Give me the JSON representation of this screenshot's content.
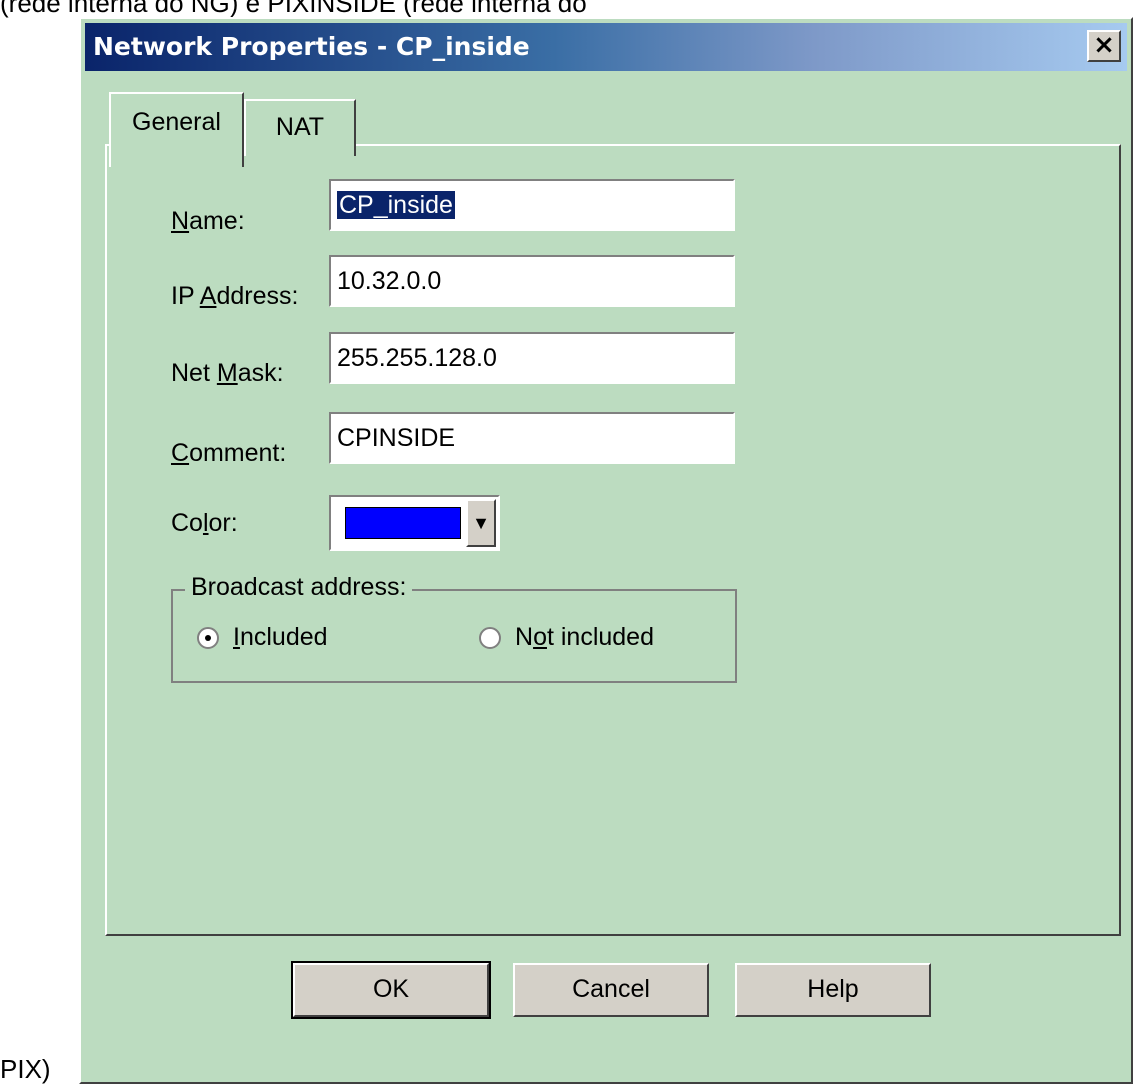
{
  "background_text": {
    "line_top": "(rede interna do                NG) e PIXINSIDE (rede interna do",
    "line_bottom": "PIX)"
  },
  "dialog": {
    "title": "Network Properties - CP_inside",
    "close_label": "×"
  },
  "tabs": [
    {
      "label": "General",
      "selected": true
    },
    {
      "label": "NAT",
      "selected": false
    }
  ],
  "form": {
    "name": {
      "label_prefix": "",
      "label_mnemonic": "N",
      "label_rest": "ame:",
      "value": "CP_inside"
    },
    "ip_address": {
      "label_prefix": "IP ",
      "label_mnemonic": "A",
      "label_rest": "ddress:",
      "value": "10.32.0.0"
    },
    "net_mask": {
      "label_prefix": "Net ",
      "label_mnemonic": "M",
      "label_rest": "ask:",
      "value": "255.255.128.0"
    },
    "comment": {
      "label_prefix": "",
      "label_mnemonic": "C",
      "label_rest": "omment:",
      "value": "CPINSIDE"
    },
    "color": {
      "label_prefix": "Co",
      "label_mnemonic": "l",
      "label_rest": "or:",
      "swatch": "#0000ff",
      "dropdown_icon": "▼"
    }
  },
  "broadcast": {
    "legend": "Broadcast address:",
    "options": [
      {
        "mnemonic": "I",
        "rest": "ncluded",
        "prefix": "",
        "checked": true
      },
      {
        "prefix": "N",
        "mnemonic": "o",
        "rest": "t included",
        "checked": false
      }
    ]
  },
  "buttons": {
    "ok": "OK",
    "cancel": "Cancel",
    "help": "Help"
  }
}
